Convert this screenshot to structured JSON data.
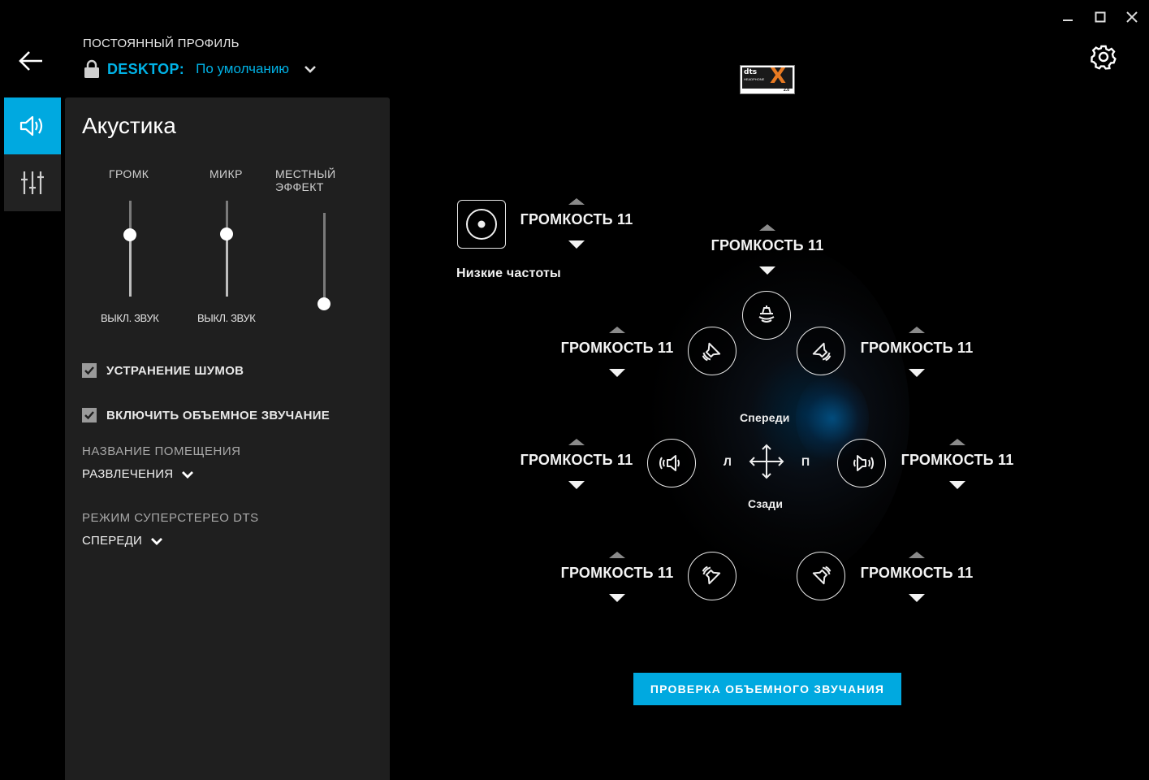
{
  "header": {
    "profile_caption": "ПОСТОЯННЫЙ ПРОФИЛЬ",
    "profile_name": "DESKTOP:",
    "profile_value": "По умолчанию"
  },
  "panel": {
    "title": "Акустика",
    "sliders": [
      {
        "label": "ГРОМК",
        "mute_label": "ВЫКЛ. ЗВУК",
        "value": 0.64
      },
      {
        "label": "МИКР",
        "mute_label": "ВЫКЛ. ЗВУК",
        "value": 0.65
      },
      {
        "label": "МЕСТНЫЙ ЭФФЕКТ",
        "mute_label": "",
        "value": 0.0
      }
    ],
    "noise_cancel": {
      "label": "УСТРАНЕНИЕ ШУМОВ",
      "checked": true
    },
    "surround": {
      "label": "ВКЛЮЧИТЬ ОБЪЕМНОЕ ЗВУЧАНИЕ",
      "checked": true
    },
    "room": {
      "label": "НАЗВАНИЕ ПОМЕЩЕНИЯ",
      "value": "РАЗВЛЕЧЕНИЯ"
    },
    "stereo": {
      "label": "РЕЖИМ СУПЕРСТЕРЕО DTS",
      "value": "СПЕРЕДИ"
    }
  },
  "logo": {
    "brand": "dts",
    "sub": "HEADPHONE",
    "mark": "X",
    "version": "2.0"
  },
  "speakers": {
    "subwoofer": {
      "label": "Низкие частоты",
      "volume": "ГРОМКОСТЬ 11"
    },
    "center": {
      "volume": "ГРОМКОСТЬ 11"
    },
    "front_left": {
      "volume": "ГРОМКОСТЬ 11"
    },
    "front_right": {
      "volume": "ГРОМКОСТЬ 11"
    },
    "side_left": {
      "volume": "ГРОМКОСТЬ 11"
    },
    "side_right": {
      "volume": "ГРОМКОСТЬ 11"
    },
    "rear_left": {
      "volume": "ГРОМКОСТЬ 11"
    },
    "rear_right": {
      "volume": "ГРОМКОСТЬ 11"
    }
  },
  "positioning": {
    "front": "Спереди",
    "rear": "Сзади",
    "left": "Л",
    "right": "П"
  },
  "test_button": "ПРОВЕРКА ОБЪЕМНОГО ЗВУЧАНИЯ",
  "colors": {
    "accent": "#00a9e0",
    "panel": "#1f1f1f",
    "background": "#000000"
  }
}
